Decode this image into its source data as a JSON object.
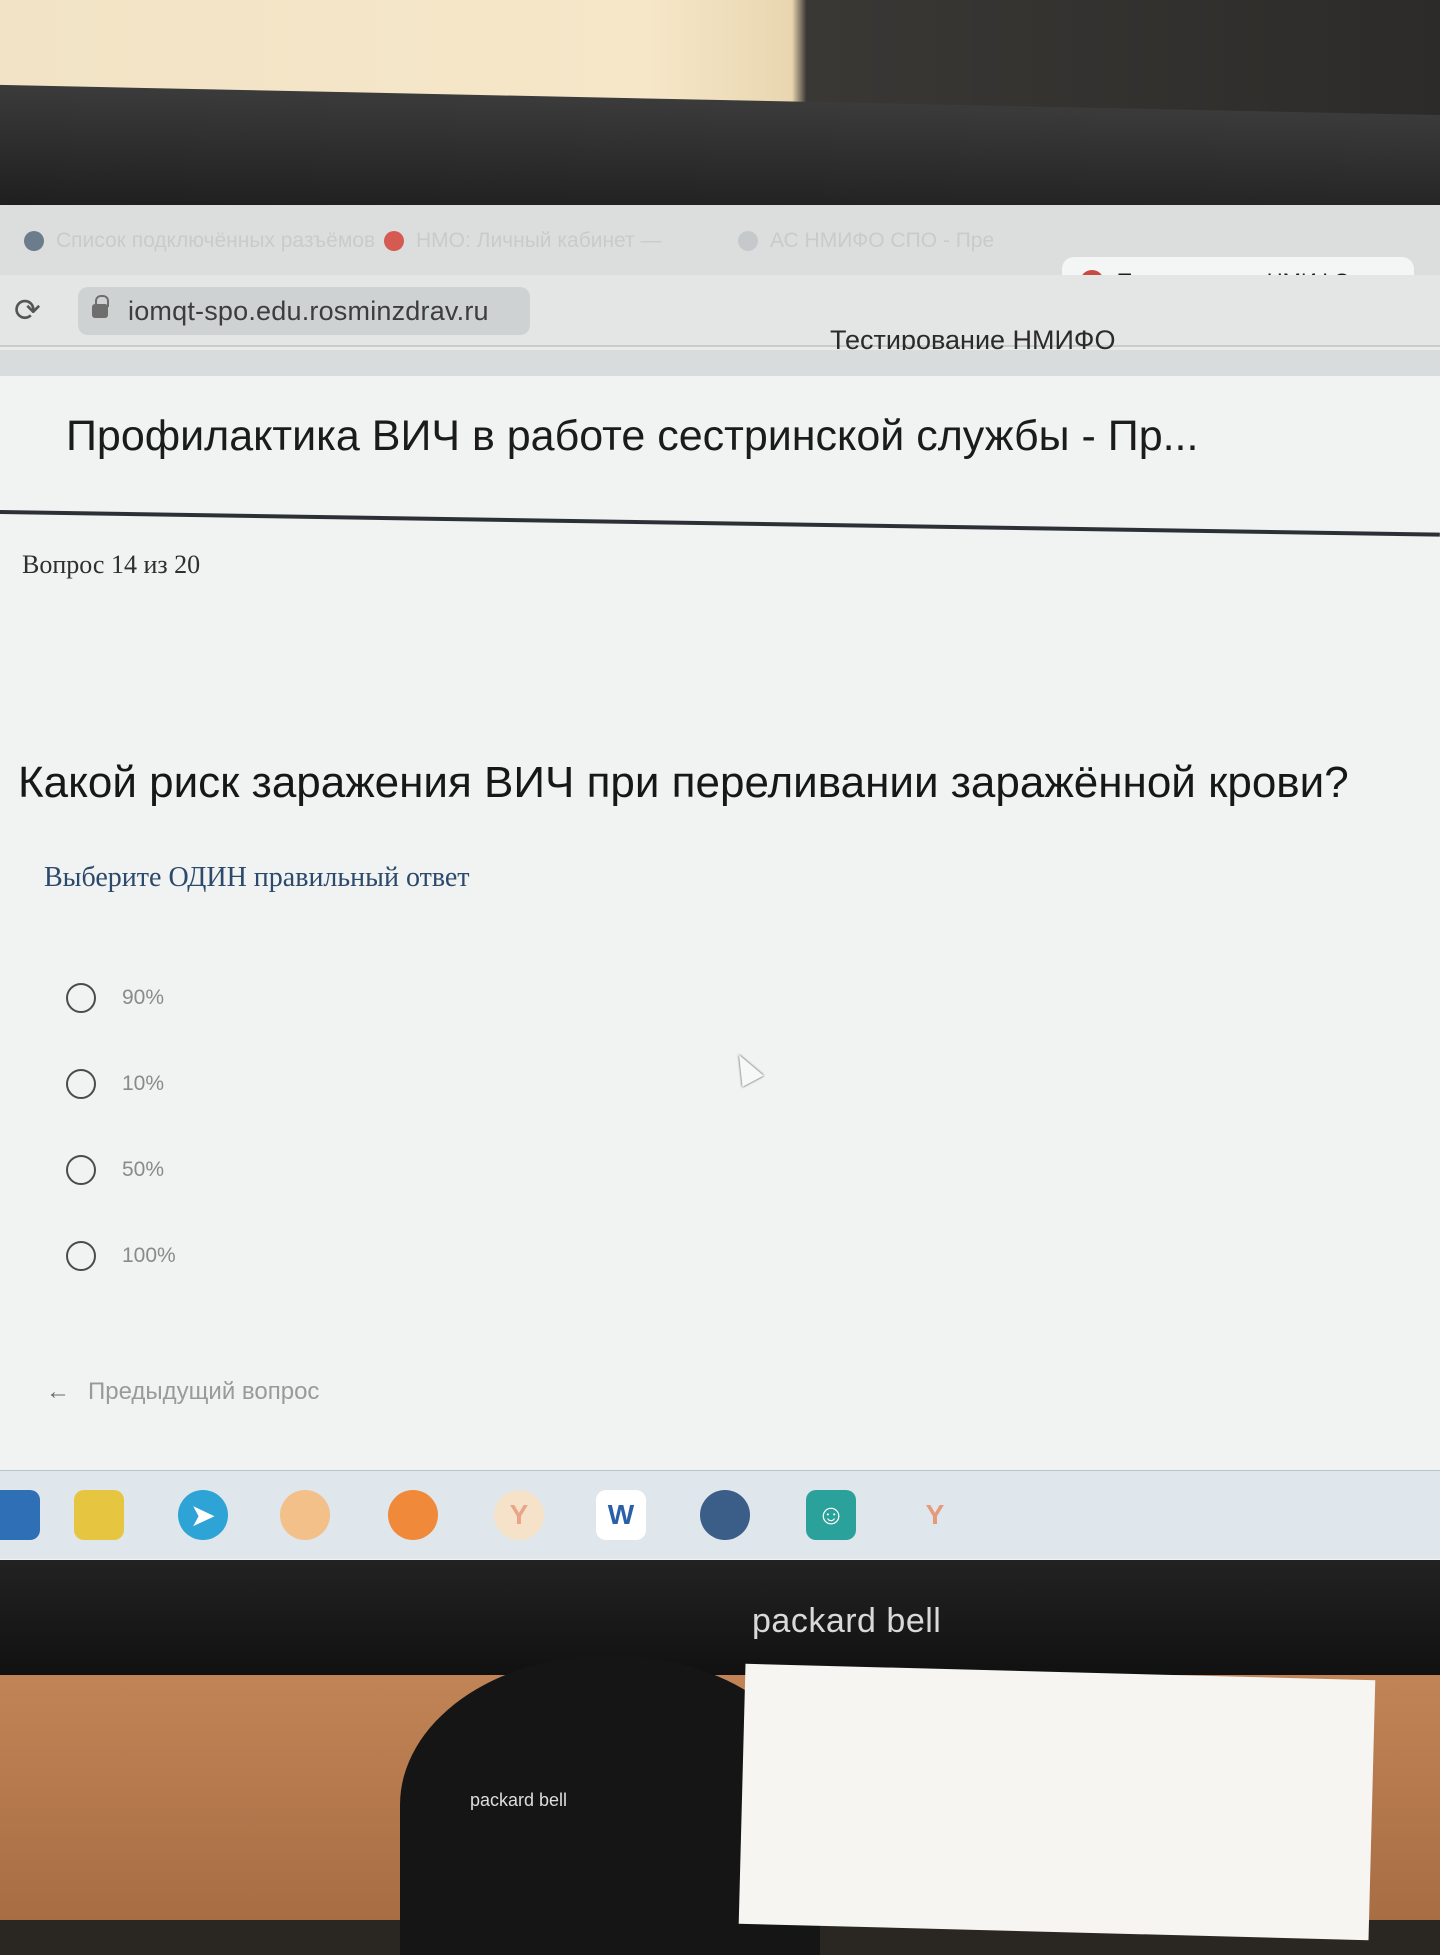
{
  "browser": {
    "tabs": [
      {
        "label": "Список подключённых разъёмов",
        "icon": "browser-icon"
      },
      {
        "label": "НМО: Личный кабинет —",
        "icon": "yandex-icon"
      },
      {
        "label": "АС НМИФО СПО - Пре",
        "icon": "globe-icon"
      }
    ],
    "active_tab": {
      "label": "Тестирование НМИФС",
      "close": "×"
    },
    "new_tab": "+",
    "url": "iomqt-spo.edu.rosminzdrav.ru",
    "page_title": "Тестирование НМИФО"
  },
  "page": {
    "course_title": "Профилактика ВИЧ в работе сестринской службы - Пр...",
    "counter": "Вопрос 14 из 20",
    "question": "Какой риск заражения ВИЧ при переливании заражённой крови?",
    "hint": "Выберите ОДИН правильный ответ",
    "options": [
      "90%",
      "10%",
      "50%",
      "100%"
    ],
    "prev_button": "Предыдущий вопрос",
    "prev_arrow": "←"
  },
  "taskbar": {
    "icons": [
      "file-manager-icon",
      "mail-icon",
      "telegram-icon",
      "media-player-icon",
      "firefox-icon",
      "yandex-browser-icon",
      "word-icon",
      "chrome-like-icon",
      "contacts-icon",
      "yandex-icon"
    ],
    "word_letter": "W",
    "yandex_letter": "Y"
  },
  "monitor": {
    "brand": "packard bell",
    "stand_brand": "packard bell"
  }
}
